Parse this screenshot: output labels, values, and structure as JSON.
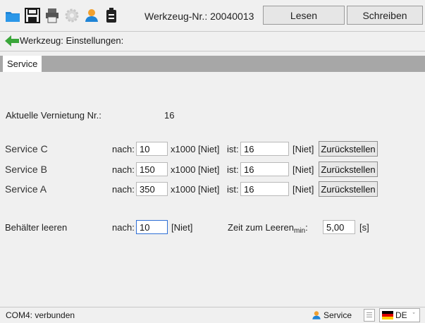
{
  "toolbar": {
    "icons": [
      "folder-icon",
      "save-icon",
      "print-icon",
      "settings-icon",
      "service-user-icon",
      "device-icon"
    ],
    "tool_number": "Werkzeug-Nr.: 20040013",
    "read_label": "Lesen",
    "write_label": "Schreiben"
  },
  "breadcrumb": {
    "label": "Werkzeug: Einstellungen:"
  },
  "tabs": [
    {
      "label": "Service",
      "active": true
    }
  ],
  "main": {
    "current_rivet_label": "Aktuelle Vernietung Nr.:",
    "current_rivet_value": "16",
    "service_rows": [
      {
        "name": "Service C",
        "after_label": "nach:",
        "after_value": "10",
        "unit": "x1000 [Niet]",
        "actual_label": "ist:",
        "actual_value": "16",
        "actual_unit": "[Niet]",
        "reset_label": "Zurückstellen"
      },
      {
        "name": "Service B",
        "after_label": "nach:",
        "after_value": "150",
        "unit": "x1000 [Niet]",
        "actual_label": "ist:",
        "actual_value": "16",
        "actual_unit": "[Niet]",
        "reset_label": "Zurückstellen"
      },
      {
        "name": "Service A",
        "after_label": "nach:",
        "after_value": "350",
        "unit": "x1000 [Niet]",
        "actual_label": "ist:",
        "actual_value": "16",
        "actual_unit": "[Niet]",
        "reset_label": "Zurückstellen"
      }
    ],
    "container": {
      "label": "Behälter leeren",
      "after_label": "nach:",
      "after_value": "10",
      "unit": "[Niet]",
      "time_label": "Zeit zum Leeren",
      "time_sub": "min",
      "time_suffix": ":",
      "time_value": "5,00",
      "time_unit": "[s]"
    }
  },
  "statusbar": {
    "connection": "COM4: verbunden",
    "service_label": "Service",
    "language": "DE"
  },
  "colors": {
    "tab_strip": "#a7a7a7",
    "focus_border": "#2f6fd6",
    "folder": "#1f84d6",
    "back_arrow": "#3aa63a"
  }
}
